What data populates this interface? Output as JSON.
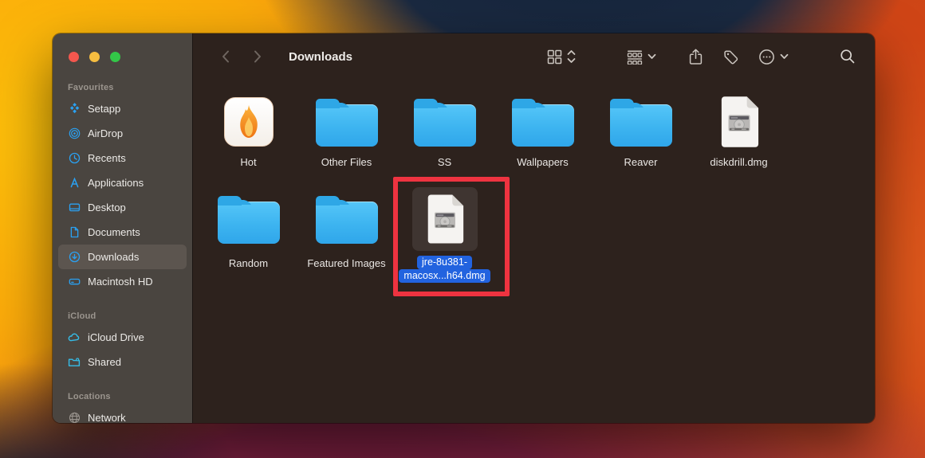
{
  "window": {
    "title": "Downloads",
    "traffic_lights": [
      "close",
      "minimize",
      "zoom"
    ]
  },
  "colors": {
    "accent_blue": "#2263df",
    "sidebar_icon_blue": "#2aa1f2",
    "icloud_icon_cyan": "#35bde8",
    "folder_blue": "#3db4f0",
    "annotation_red": "#ee3340",
    "traffic_red": "#f4574e",
    "traffic_yellow": "#f6bd40",
    "traffic_green": "#33c748",
    "sidebar_bg": "#4a4540",
    "pane_bg": "#2d221d"
  },
  "toolbar": {
    "title": "Downloads",
    "icons": [
      "back",
      "forward",
      "icon-view",
      "view-chooser",
      "group-by",
      "group-by-menu",
      "share",
      "tags",
      "more-actions",
      "more-actions-menu",
      "search"
    ]
  },
  "sidebar": {
    "sections": [
      {
        "header": "Favourites",
        "items": [
          {
            "label": "Setapp"
          },
          {
            "label": "AirDrop"
          },
          {
            "label": "Recents"
          },
          {
            "label": "Applications"
          },
          {
            "label": "Desktop"
          },
          {
            "label": "Documents"
          },
          {
            "label": "Downloads",
            "selected": true
          },
          {
            "label": "Macintosh HD"
          }
        ]
      },
      {
        "header": "iCloud",
        "items": [
          {
            "label": "iCloud Drive"
          },
          {
            "label": "Shared"
          }
        ]
      },
      {
        "header": "Locations",
        "items": [
          {
            "label": "Network"
          }
        ]
      }
    ]
  },
  "files": {
    "row1": [
      {
        "name": "Hot",
        "kind": "application"
      },
      {
        "name": "Other Files",
        "kind": "folder"
      },
      {
        "name": "SS",
        "kind": "folder"
      },
      {
        "name": "Wallpapers",
        "kind": "folder"
      },
      {
        "name": "Reaver",
        "kind": "folder"
      },
      {
        "name": "diskdrill.dmg",
        "kind": "disk-image"
      }
    ],
    "row2": [
      {
        "name": "Random",
        "kind": "folder"
      },
      {
        "name": "Featured Images",
        "kind": "folder"
      },
      {
        "name": "jre-8u381-macosx...h64.dmg",
        "kind": "disk-image",
        "selected": true,
        "label_line1": "jre-8u381-",
        "label_line2": "macosx...h64.dmg"
      }
    ]
  },
  "annotation": {
    "shape": "red-rectangle",
    "color": "#ee3340"
  }
}
